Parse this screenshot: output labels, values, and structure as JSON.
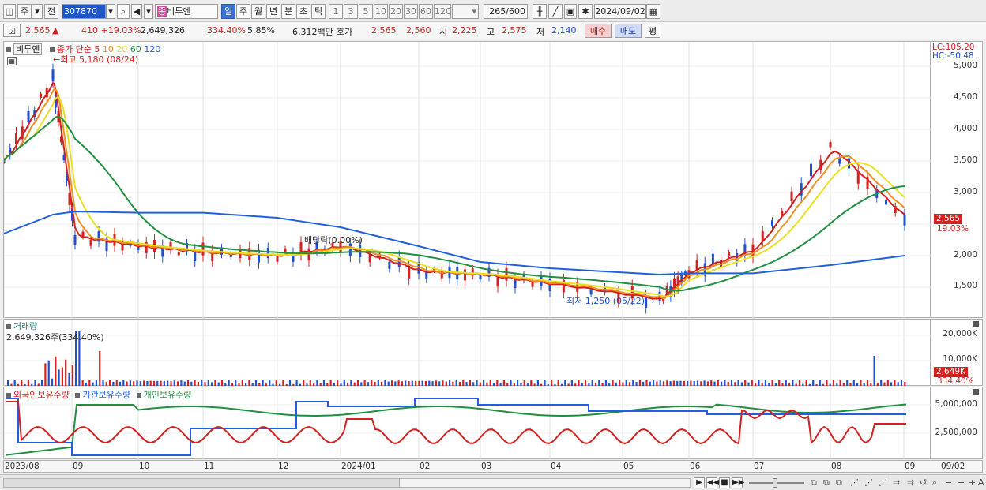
{
  "toolbar": {
    "period_labels": [
      "주",
      "전"
    ],
    "code": "307870",
    "badge": "종",
    "name": "비투엔",
    "timeframes": [
      "일",
      "주",
      "월",
      "년",
      "분",
      "초",
      "틱"
    ],
    "selected_timeframe": "일",
    "intervals": [
      "1",
      "3",
      "5",
      "10",
      "20",
      "30",
      "60",
      "120"
    ],
    "count_value": "265",
    "count_max": "/600",
    "date": "2024/09/02"
  },
  "quote": {
    "price": "2,565",
    "change": "410 +19.03%",
    "volume": "2,649,326",
    "vol_ratio": "334.40%",
    "turnover": "5.85%",
    "amount": "6,312백만",
    "ask_label": "호가",
    "ask": "2,565",
    "bid": "2,560",
    "open_label": "시",
    "open": "2,225",
    "high_label": "고",
    "high": "2,575",
    "low_label": "저",
    "low": "2,140",
    "buy": "매수",
    "sell": "매도",
    "eval": "평"
  },
  "price_pane": {
    "name": "비투엔",
    "legend_prefix": "종가 단순",
    "ma_labels": [
      "5",
      "10",
      "20",
      "60",
      "120"
    ],
    "ma_colors": [
      "#d42020",
      "#f09020",
      "#e8e020",
      "#209040",
      "#2060e0"
    ],
    "high_note": "←최고 5,180 (08/24)",
    "low_note": "최저 1,250 (05/22) →",
    "dividend_note": "배당락(0.00%)",
    "lc": "LC:105.20",
    "hc": "HC:-50.48",
    "y_ticks": [
      "5,000",
      "4,500",
      "4,000",
      "3,500",
      "3,000",
      "2,500",
      "2,000",
      "1,500"
    ],
    "current_tag": "2,565",
    "current_pct": "19.03%"
  },
  "volume_pane": {
    "title": "거래량",
    "info": "2,649,326주(334.40%)",
    "y_ticks": [
      "20,000K",
      "10,000K"
    ],
    "current_tag": "2,649K",
    "current_pct": "334.40%"
  },
  "holding_pane": {
    "legend": [
      "외국인보유수량",
      "기관보유수량",
      "개인보유수량"
    ],
    "colors": [
      "#d42020",
      "#2060e0",
      "#209040"
    ],
    "y_ticks": [
      "5,000,000",
      "2,500,000"
    ]
  },
  "x_axis": {
    "labels": [
      "2023/08",
      "09",
      "10",
      "11",
      "12",
      "2024/01",
      "02",
      "03",
      "04",
      "05",
      "06",
      "07",
      "08",
      "09"
    ],
    "right_label": "09/02"
  },
  "chart_data": [
    {
      "type": "line",
      "title": "",
      "series": [
        {
          "name": "close",
          "x": [
            "2023/08",
            "2023/08/24",
            "09",
            "10",
            "11",
            "12",
            "2024/01",
            "02",
            "03",
            "04",
            "05/22",
            "06",
            "07",
            "08",
            "09/02"
          ],
          "values": [
            3500,
            4800,
            2300,
            2150,
            2050,
            2000,
            2150,
            1750,
            1700,
            1550,
            1300,
            1750,
            2100,
            3700,
            2565
          ]
        },
        {
          "name": "120",
          "values": [
            2350,
            2650,
            2700,
            2680,
            2680,
            2600,
            2450,
            2150,
            1900,
            1800,
            1700,
            1720,
            1720,
            1850,
            2000
          ]
        }
      ]
    }
  ]
}
